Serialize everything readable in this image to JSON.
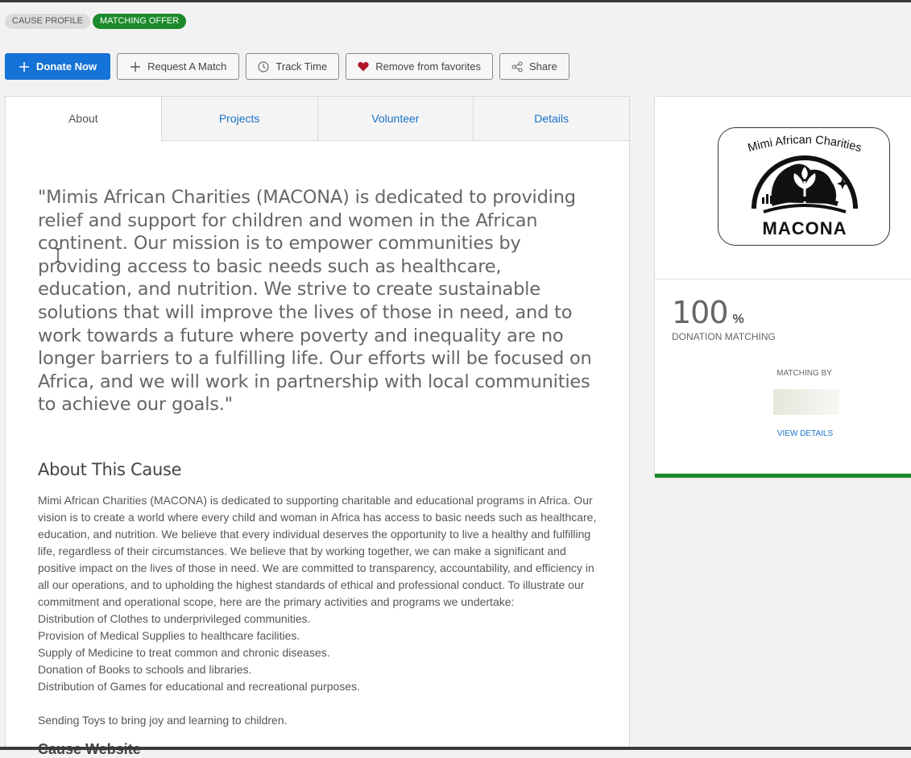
{
  "badges": {
    "profile": "CAUSE PROFILE",
    "matching": "MATCHING OFFER"
  },
  "toolbar": {
    "donate": "Donate Now",
    "request_match": "Request A Match",
    "track_time": "Track Time",
    "remove_favorites": "Remove from favorites",
    "share": "Share"
  },
  "tabs": [
    {
      "label": "About",
      "active": true
    },
    {
      "label": "Projects",
      "active": false
    },
    {
      "label": "Volunteer",
      "active": false
    },
    {
      "label": "Details",
      "active": false
    }
  ],
  "about": {
    "quote": "\"Mimis African Charities (MACONA) is dedicated to providing relief and support for children and women in the African continent. Our mission is to empower communities by providing access to basic needs such as healthcare, education, and nutrition. We strive to create sustainable solutions that will improve the lives of those in need, and to work towards a future where poverty and inequality are no longer barriers to a fulfilling life. Our efforts will be focused on Africa, and we will work in partnership with local communities to achieve our goals.\"",
    "section_title": "About This Cause",
    "description": "Mimi African Charities (MACONA) is dedicated to supporting charitable and educational programs in Africa. Our vision is to create a world where every child and woman in Africa has access to basic needs such as healthcare, education, and nutrition. We believe that every individual deserves the opportunity to live a healthy and fulfilling life, regardless of their circumstances. We believe that by working together, we can make a significant and positive impact on the lives of those in need. We are committed to transparency, accountability, and efficiency in all our operations, and to upholding the highest standards of ethical and professional conduct. To illustrate our commitment and operational scope, here are the primary activities and programs we undertake:",
    "activities": [
      "Distribution of Clothes to underprivileged communities.",
      "Provision of Medical Supplies to healthcare facilities.",
      "Supply of Medicine to treat common and chronic diseases.",
      "Donation of Books to schools and libraries.",
      "Distribution of Games for educational and recreational purposes."
    ],
    "closing": "Sending Toys to bring joy and learning to children.",
    "website_title": "Cause Website"
  },
  "sidebar": {
    "logo_arc_text": "Mimi African Charities",
    "logo_word": "MACONA",
    "match_percent": "100",
    "percent_sign": "%",
    "match_label": "DONATION MATCHING",
    "matching_by": "MATCHING BY",
    "view_details": "VIEW DETAILS"
  },
  "colors": {
    "primary": "#1572d6",
    "matching_green": "#1b8a2a",
    "link": "#1a73c9",
    "heart": "#b0132b"
  },
  "icons": {
    "donate": "plus-icon",
    "request_match": "plus-icon",
    "track_time": "clock-icon",
    "remove_favorites": "heart-icon",
    "share": "share-icon"
  }
}
